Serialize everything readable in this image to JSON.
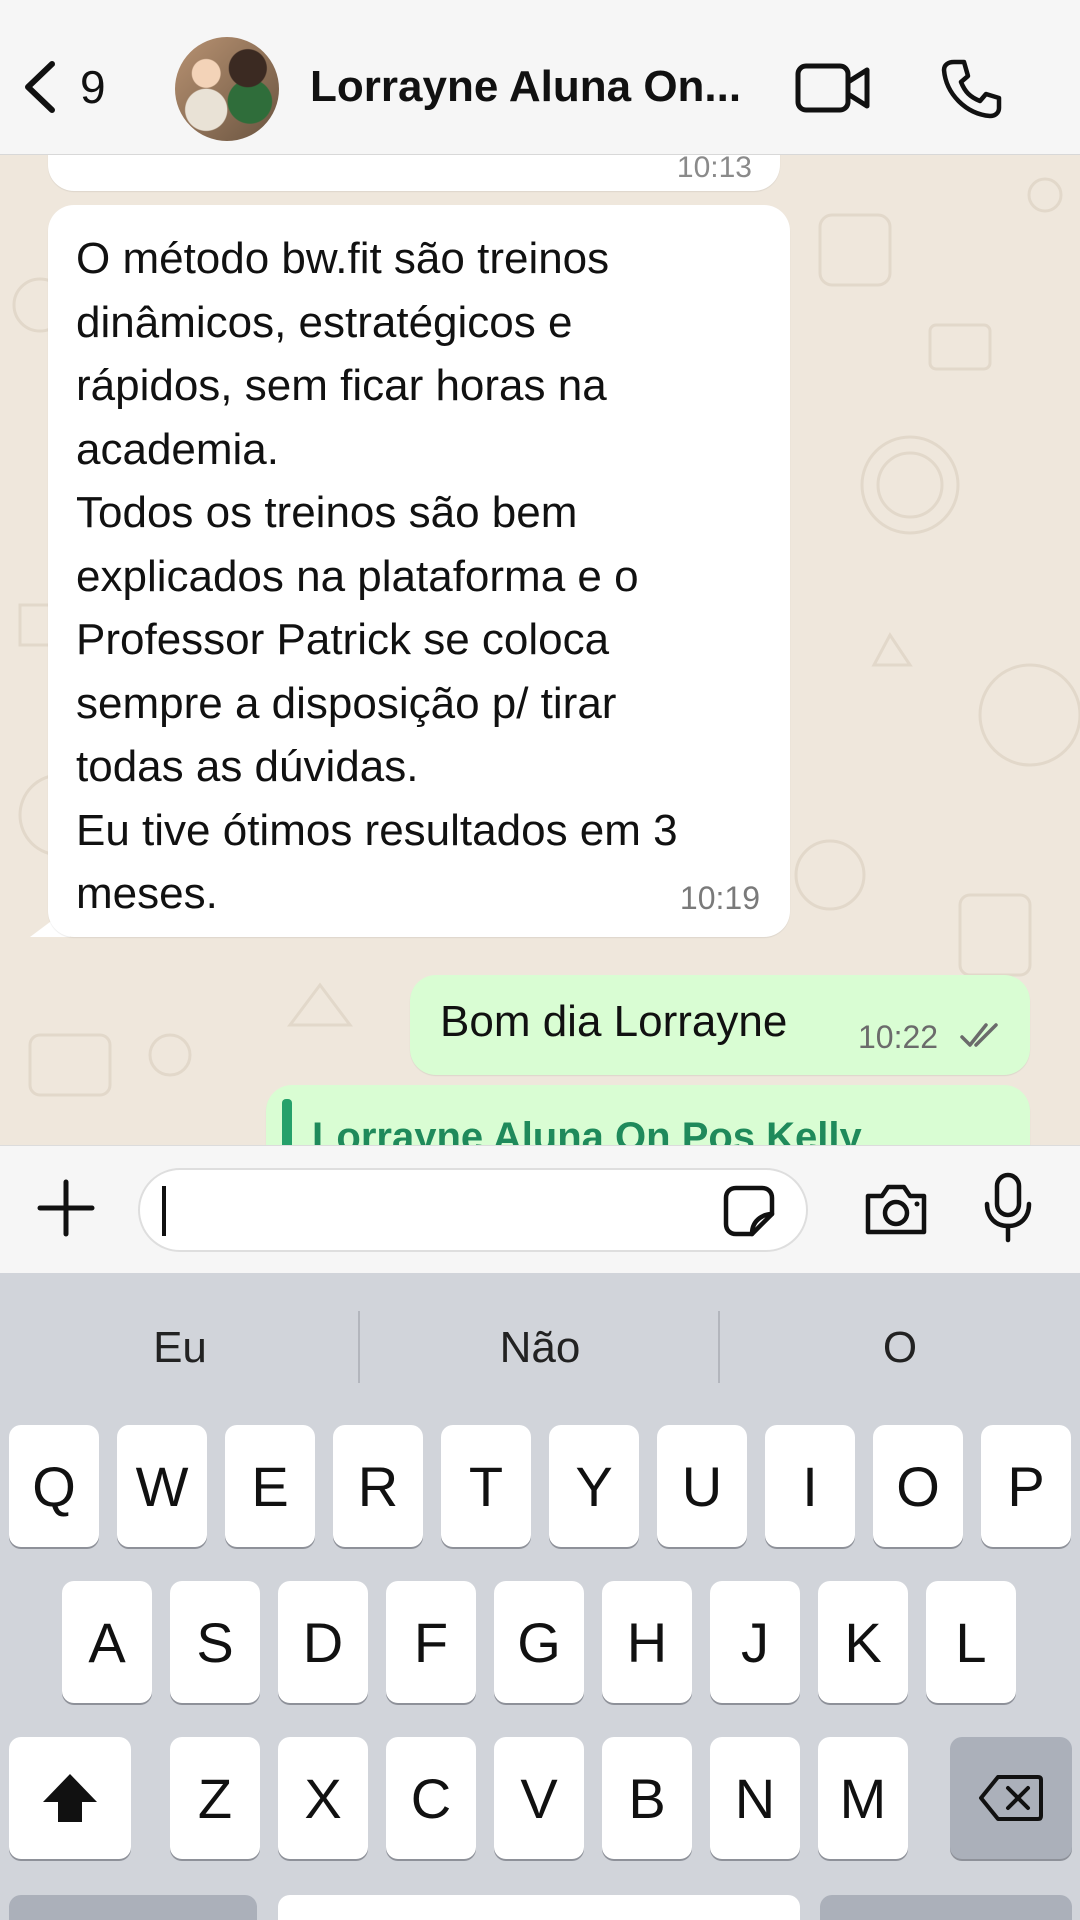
{
  "header": {
    "back_count": "9",
    "contact_name": "Lorrayne Aluna On...",
    "icons": {
      "back": "chevron-left-icon",
      "video": "video-camera-icon",
      "call": "phone-icon"
    }
  },
  "chat": {
    "previous_message": {
      "time": "10:13"
    },
    "messages": [
      {
        "direction": "incoming",
        "text": "O método bw.fit são treinos\ndinâmicos, estratégicos e\nrápidos, sem ficar horas na\nacademia.\nTodos os treinos são bem\nexplicados na plataforma e o\nProfessor Patrick se coloca\nsempre a disposição p/ tirar\ntodas as dúvidas.\nEu tive ótimos resultados em 3\nmeses.",
        "time": "10:19"
      },
      {
        "direction": "outgoing",
        "text": "Bom dia Lorrayne",
        "time": "10:22",
        "status": "double-check-icon"
      },
      {
        "direction": "outgoing",
        "quote_author": "Lorrayne Aluna On Pos Kelly"
      }
    ]
  },
  "inputbar": {
    "value": "",
    "icons": {
      "plus": "plus-icon",
      "sticker": "sticker-icon",
      "camera": "camera-icon",
      "mic": "microphone-icon"
    }
  },
  "keyboard": {
    "suggestions": [
      "Eu",
      "Não",
      "O"
    ],
    "row1": [
      "Q",
      "W",
      "E",
      "R",
      "T",
      "Y",
      "U",
      "I",
      "O",
      "P"
    ],
    "row2": [
      "A",
      "S",
      "D",
      "F",
      "G",
      "H",
      "J",
      "K",
      "L"
    ],
    "row3": [
      "Z",
      "X",
      "C",
      "V",
      "B",
      "N",
      "M"
    ],
    "icons": {
      "shift": "shift-icon",
      "backspace": "backspace-icon"
    }
  }
}
